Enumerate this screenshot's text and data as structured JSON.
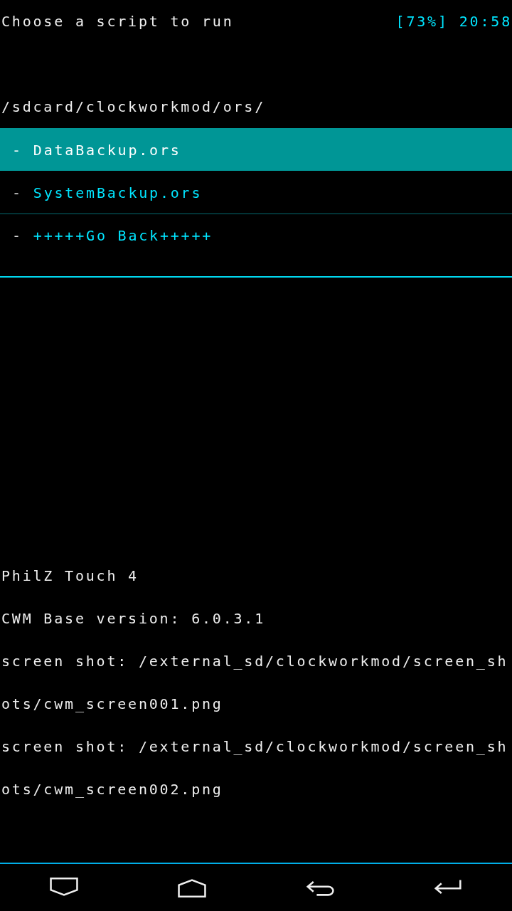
{
  "header": {
    "title": "Choose a script to run",
    "battery": "[73%]",
    "time": "20:58"
  },
  "path": "/sdcard/clockworkmod/ors/",
  "menu_items": [
    {
      "marker": "-",
      "label": "DataBackup.ors",
      "selected": true
    },
    {
      "marker": "-",
      "label": "SystemBackup.ors",
      "selected": false
    },
    {
      "marker": "-",
      "label": "+++++Go Back+++++",
      "selected": false
    }
  ],
  "log_lines": [
    "PhilZ Touch 4",
    "CWM Base version: 6.0.3.1",
    "screen shot: /external_sd/clockworkmod/screen_sh",
    "ots/cwm_screen001.png",
    "screen shot: /external_sd/clockworkmod/screen_sh",
    "ots/cwm_screen002.png"
  ],
  "nav_buttons": [
    {
      "kind": "down"
    },
    {
      "kind": "home"
    },
    {
      "kind": "back"
    },
    {
      "kind": "enter"
    }
  ]
}
